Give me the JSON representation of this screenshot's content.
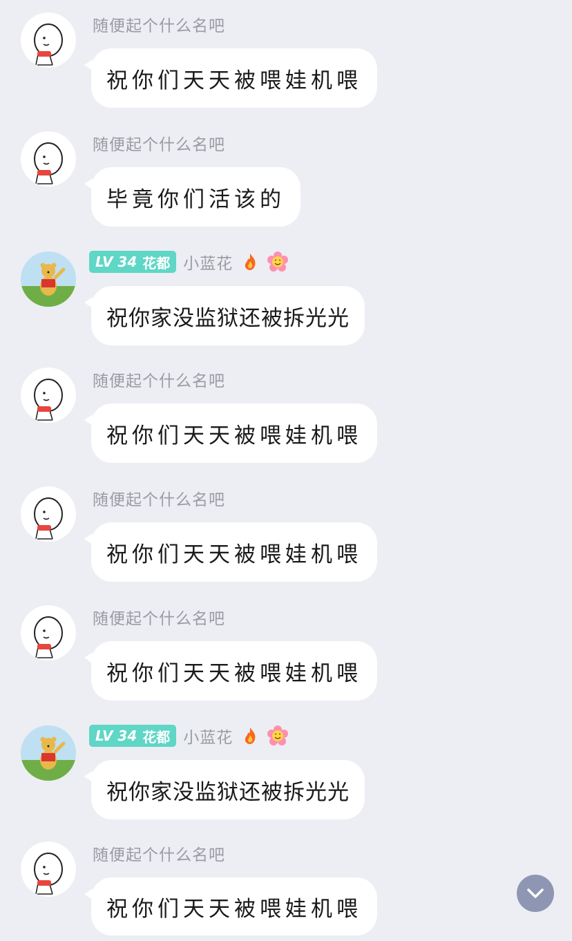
{
  "messages": [
    {
      "user": "随便起个什么名吧",
      "text": "祝你们天天被喂娃机喂",
      "avatar": "stickman-avatar"
    },
    {
      "user": "随便起个什么名吧",
      "text": "毕竟你们活该的",
      "avatar": "stickman-avatar"
    },
    {
      "user": "小蓝花",
      "badge_level": "LV 34",
      "badge_group": "花都",
      "text": "祝你家没监狱还被拆光光",
      "avatar": "bear-avatar",
      "emojis": [
        "fire-emoji",
        "flower-emoji"
      ]
    },
    {
      "user": "随便起个什么名吧",
      "text": "祝你们天天被喂娃机喂",
      "avatar": "stickman-avatar"
    },
    {
      "user": "随便起个什么名吧",
      "text": "祝你们天天被喂娃机喂",
      "avatar": "stickman-avatar"
    },
    {
      "user": "随便起个什么名吧",
      "text": "祝你们天天被喂娃机喂",
      "avatar": "stickman-avatar"
    },
    {
      "user": "小蓝花",
      "badge_level": "LV 34",
      "badge_group": "花都",
      "text": "祝你家没监狱还被拆光光",
      "avatar": "bear-avatar",
      "emojis": [
        "fire-emoji",
        "flower-emoji"
      ]
    },
    {
      "user": "随便起个什么名吧",
      "text": "祝你们天天被喂娃机喂",
      "avatar": "stickman-avatar"
    }
  ],
  "scroll_button": {
    "icon": "chevron-down-icon"
  },
  "colors": {
    "background": "#eceef3",
    "bubble": "#ffffff",
    "badge": "#5fd6c6",
    "name": "#9a9ca3",
    "scroll_button": "#8f96b3"
  }
}
